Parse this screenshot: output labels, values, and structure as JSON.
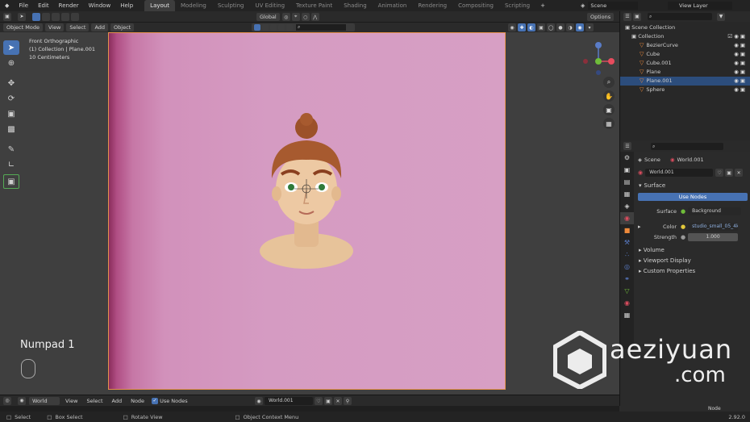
{
  "menu": {
    "items": [
      "File",
      "Edit",
      "Render",
      "Window",
      "Help"
    ]
  },
  "workspaces": [
    "Layout",
    "Modeling",
    "Sculpting",
    "UV Editing",
    "Texture Paint",
    "Shading",
    "Animation",
    "Rendering",
    "Compositing",
    "Scripting"
  ],
  "active_workspace": "Layout",
  "scene": {
    "name": "Scene",
    "view_layer": "View Layer"
  },
  "header": {
    "mode": "Object Mode",
    "menu": [
      "View",
      "Select",
      "Add",
      "Object"
    ],
    "transform": "Global",
    "options": "Options"
  },
  "viewport": {
    "line1": "Front Orthographic",
    "line2": "(1) Collection | Plane.001",
    "line3": "10 Centimeters",
    "overlay_text": "Numpad 1"
  },
  "outliner": {
    "root": "Scene Collection",
    "collection": "Collection",
    "items": [
      {
        "name": "BezierCurve",
        "selected": false
      },
      {
        "name": "Cube",
        "selected": false
      },
      {
        "name": "Cube.001",
        "selected": false
      },
      {
        "name": "Plane",
        "selected": false
      },
      {
        "name": "Plane.001",
        "selected": true
      },
      {
        "name": "Sphere",
        "selected": false
      }
    ]
  },
  "properties": {
    "scene": "Scene",
    "world": "World.001",
    "world_field": "World.001",
    "surface_label": "Surface",
    "use_nodes": "Use Nodes",
    "surface_field_label": "Surface",
    "surface_value": "Background",
    "color_label": "Color",
    "color_value": "studio_small_05_4k...",
    "strength_label": "Strength",
    "strength_value": "1.000",
    "volume": "Volume",
    "viewport_display": "Viewport Display",
    "custom_properties": "Custom Properties"
  },
  "bottom_header": {
    "type": "World",
    "menu": [
      "View",
      "Select",
      "Add",
      "Node"
    ],
    "use_nodes": "Use Nodes",
    "world": "World.001"
  },
  "node_panel_label": "Node",
  "status": {
    "select": "Select",
    "box_select": "Box Select",
    "rotate": "Rotate View",
    "context": "Object Context Menu",
    "version": "2.92.0"
  },
  "watermark": {
    "line1": "aeziyuan",
    "line2": ".com"
  },
  "colors": {
    "accent": "#4772b3",
    "camera_frame": "#e6914d",
    "selected_row": "#2c4d7c",
    "object_icon": "#ee8a3b"
  }
}
